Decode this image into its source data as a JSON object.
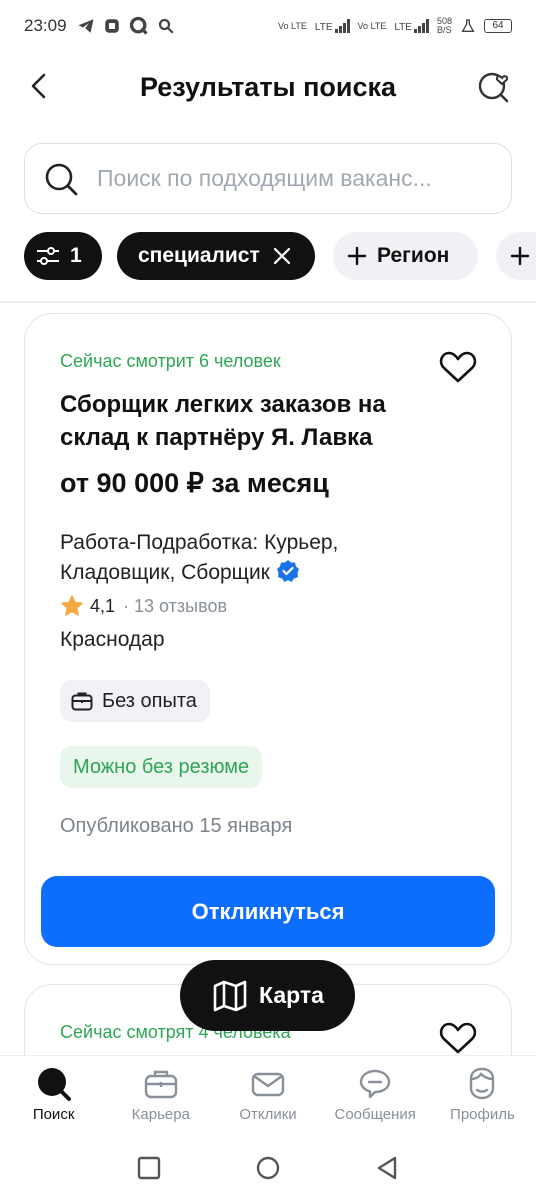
{
  "status_bar": {
    "time": "23:09",
    "network": [
      "Vo LTE",
      "LTE",
      "Vo LTE",
      "LTE"
    ],
    "speed_value": "508",
    "speed_unit": "B/S",
    "battery": "64"
  },
  "header": {
    "title": "Результаты поиска"
  },
  "search": {
    "placeholder": "Поиск по подходящим ваканс..."
  },
  "chips": {
    "filter_count": "1",
    "query_chip": "специалист",
    "region_chip": "Регион"
  },
  "vacancies": [
    {
      "viewers": "Сейчас смотрит 6 человек",
      "title": "Сборщик легких заказов на склад к партнёру Я. Лавка",
      "salary": "от 90 000 ₽ за месяц",
      "company": "Работа-Подработка: Курьер, Кладовщик, Сборщик",
      "rating": "4,1",
      "reviews": "· 13 отзывов",
      "city": "Краснодар",
      "experience": "Без опыта",
      "resume_badge": "Можно без резюме",
      "published": "Опубликовано 15 января",
      "apply_label": "Откликнуться"
    },
    {
      "viewers": "Сейчас смотрят 4 человека"
    }
  ],
  "map_button": "Карта",
  "tabs": [
    {
      "label": "Поиск",
      "icon": "search-icon",
      "active": true
    },
    {
      "label": "Карьера",
      "icon": "briefcase-icon",
      "active": false
    },
    {
      "label": "Отклики",
      "icon": "envelope-icon",
      "active": false
    },
    {
      "label": "Сообщения",
      "icon": "chat-icon",
      "active": false
    },
    {
      "label": "Профиль",
      "icon": "profile-icon",
      "active": false
    }
  ],
  "colors": {
    "accent": "#0d6efd",
    "green": "#2ea655",
    "dark_chip": "#111111"
  }
}
